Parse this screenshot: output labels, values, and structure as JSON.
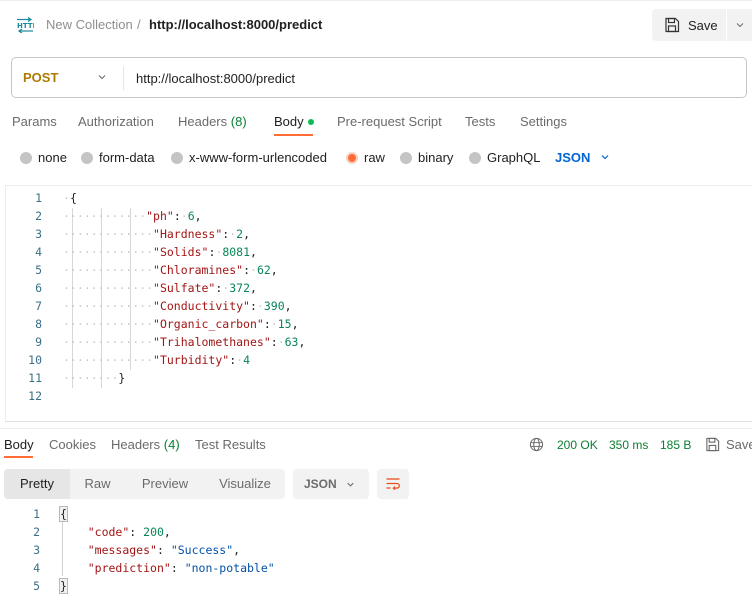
{
  "header": {
    "icon": "http-request-icon",
    "collection": "New Collection",
    "separator": "/",
    "request_name": "http://localhost:8000/predict",
    "save_label": "Save"
  },
  "request": {
    "method": "POST",
    "url": "http://localhost:8000/predict",
    "method_color": "#ad7a03"
  },
  "request_tabs": [
    {
      "label": "Params",
      "active": false
    },
    {
      "label": "Authorization",
      "active": false
    },
    {
      "label": "Headers",
      "count": "(8)",
      "active": false
    },
    {
      "label": "Body",
      "active": true,
      "indicator": "green-dot"
    },
    {
      "label": "Pre-request Script",
      "active": false
    },
    {
      "label": "Tests",
      "active": false
    },
    {
      "label": "Settings",
      "active": false
    }
  ],
  "body_types": [
    {
      "label": "none",
      "selected": false
    },
    {
      "label": "form-data",
      "selected": false
    },
    {
      "label": "x-www-form-urlencoded",
      "selected": false
    },
    {
      "label": "raw",
      "selected": true
    },
    {
      "label": "binary",
      "selected": false
    },
    {
      "label": "GraphQL",
      "selected": false
    }
  ],
  "body_language": "JSON",
  "request_body": {
    "line_numbers": [
      "1",
      "2",
      "3",
      "4",
      "5",
      "6",
      "7",
      "8",
      "9",
      "10",
      "11",
      "12"
    ],
    "fields": [
      {
        "key": "ph",
        "value": "6"
      },
      {
        "key": "Hardness",
        "value": "2"
      },
      {
        "key": "Solids",
        "value": "8081"
      },
      {
        "key": "Chloramines",
        "value": "62"
      },
      {
        "key": "Sulfate",
        "value": "372"
      },
      {
        "key": "Conductivity",
        "value": "390"
      },
      {
        "key": "Organic_carbon",
        "value": "15"
      },
      {
        "key": "Trihalomethanes",
        "value": "63"
      },
      {
        "key": "Turbidity",
        "value": "4"
      }
    ],
    "open_brace": "{",
    "close_brace": "}"
  },
  "response_tabs": [
    {
      "label": "Body",
      "active": true
    },
    {
      "label": "Cookies",
      "active": false
    },
    {
      "label": "Headers",
      "count": "(4)",
      "active": false
    },
    {
      "label": "Test Results",
      "active": false
    }
  ],
  "response_meta": {
    "status": "200 OK",
    "time": "350 ms",
    "size": "185 B",
    "save_label": "Save",
    "status_color": "#0a7f34"
  },
  "response_views": [
    {
      "label": "Pretty",
      "active": true
    },
    {
      "label": "Raw",
      "active": false
    },
    {
      "label": "Preview",
      "active": false
    },
    {
      "label": "Visualize",
      "active": false
    }
  ],
  "response_format": "JSON",
  "response_body": {
    "line_numbers": [
      "1",
      "2",
      "3",
      "4",
      "5"
    ],
    "open_brace": "{",
    "close_brace": "}",
    "fields": [
      {
        "key": "code",
        "value": "200",
        "type": "number"
      },
      {
        "key": "messages",
        "value": "\"Success\"",
        "type": "string"
      },
      {
        "key": "prediction",
        "value": "\"non-potable\"",
        "type": "string"
      }
    ]
  },
  "colors": {
    "accent": "#ff6c37",
    "link_blue": "#0265d2",
    "success_green": "#0a7f34"
  }
}
